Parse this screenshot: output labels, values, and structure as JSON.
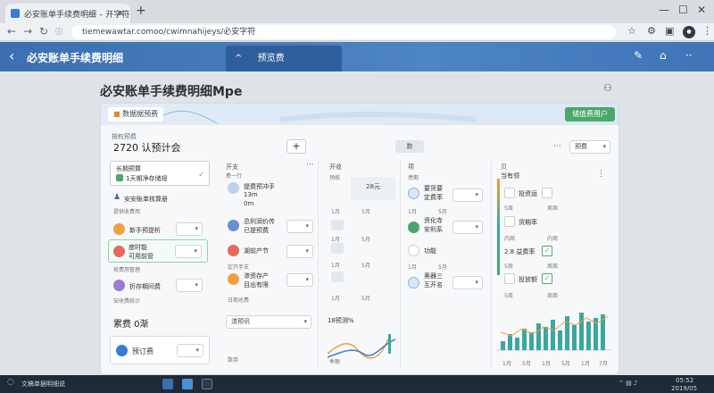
{
  "browser": {
    "tab_title": "必安账单手续费明细 – 开字符",
    "url": "tiemewawtar.comoo/cwimnahijeys/必安字符",
    "new_tab": "+",
    "tab_close": "×"
  },
  "appbar": {
    "back": "‹",
    "title": "必安账单手续费明细",
    "preview_chevron": "^",
    "preview_label": "预览费"
  },
  "page": {
    "title": "必安账单手续费明细Mpe",
    "hero_button": "数据据预费",
    "green_button": "储值费用户",
    "sublabel": "按权预费",
    "big_title": "2720 认预计会",
    "plus": "+",
    "gray_button": "数",
    "more": "···",
    "select_label": "预费"
  },
  "col1": {
    "card_title": "长期预算",
    "card_sub": "1天期净存储规",
    "row1": "安安账单核算册",
    "row1_sub": "提供收费用",
    "item1": "新手预提析",
    "item2_title": "度时能",
    "item2_sub": "可用前管",
    "item2_caption": "按费用管理",
    "item3": "折存期间费",
    "item3_caption": "安收费统计",
    "bottom_title": "累费 0渐",
    "bottom_item": "预订费"
  },
  "col2": {
    "header": "开支",
    "sub": "费一行",
    "items": [
      {
        "title": "提费预冲手",
        "sub": "13m",
        "sub2": "0m"
      },
      {
        "title": "总利润价传",
        "sub": "已提预费"
      },
      {
        "title": "湖前产节",
        "sub": "定开手支"
      },
      {
        "title": "渗资存产",
        "sub": "目出有限"
      }
    ],
    "caption": "日期总费",
    "select": "渣预讯",
    "footer": "数券"
  },
  "col3": {
    "header": "开收",
    "sub": "预按",
    "value_box": "28元",
    "ticks": [
      "1月",
      "5月",
      "1月",
      "5月",
      "1月",
      "5月",
      "1月",
      "5月"
    ],
    "line_label": "18预测%",
    "footer": "季额"
  },
  "col4": {
    "header": "项",
    "sub": "债期",
    "items": [
      {
        "title": "要货要",
        "sub": "定费率"
      },
      {
        "title": "资化寺",
        "sub": "安利系"
      },
      {
        "title": "功能",
        "sub": ""
      },
      {
        "title": "奥器三",
        "sub": "互开名"
      }
    ],
    "ticks": [
      "1月",
      "5月",
      "1月",
      "5月"
    ]
  },
  "col5": {
    "header": "贝",
    "sub": "当有领",
    "items": [
      "投资运",
      "货期率",
      "2.8 益费率",
      "投放额"
    ],
    "small": [
      "5周",
      "周周",
      "内周",
      "内周",
      "5周",
      "周周",
      "5周",
      "周周"
    ],
    "chart_ticks": [
      "1月",
      "5月",
      "1月",
      "5月",
      "1月",
      "7月"
    ]
  },
  "taskbar": {
    "search": "文稿单据明细说",
    "time": "05:52",
    "date": "2019/05"
  },
  "colors": {
    "appbar": "#3f75b6",
    "accent_green": "#4aa86a",
    "teal": "#3aa7a0",
    "orange": "#f0a040"
  }
}
